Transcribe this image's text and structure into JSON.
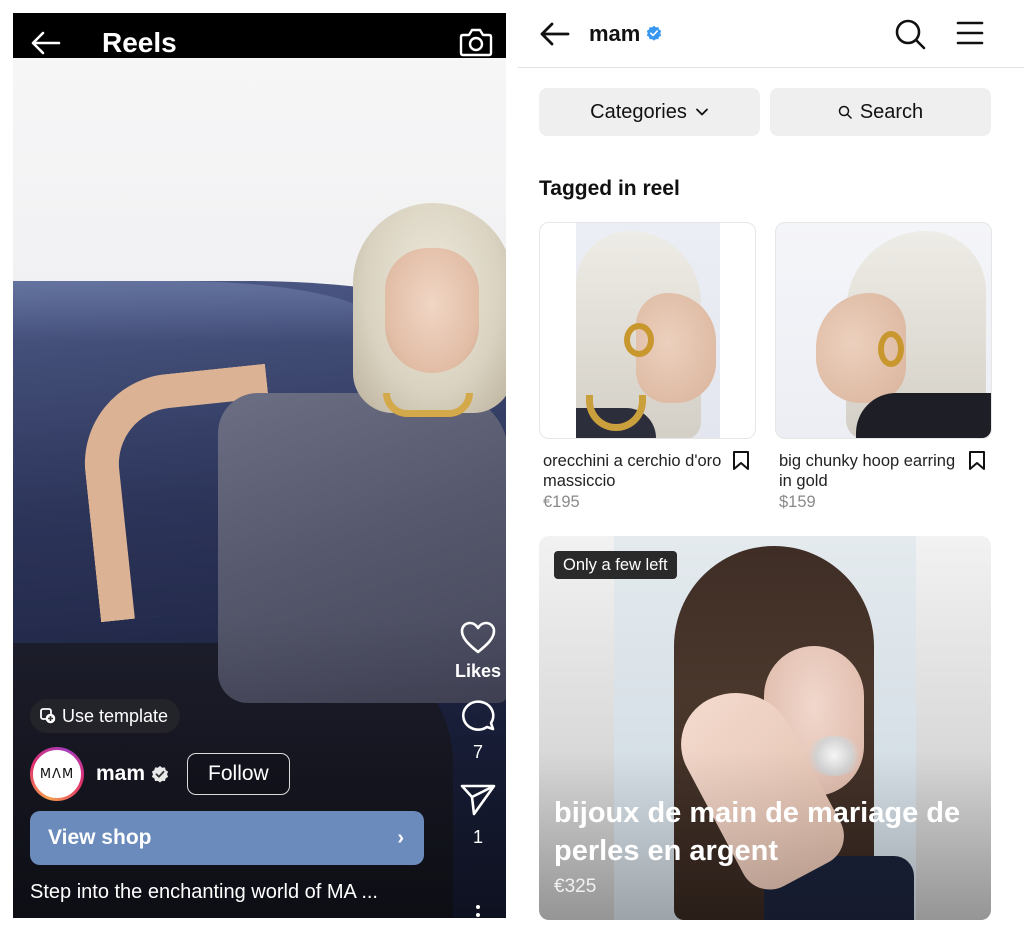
{
  "reels": {
    "header": {
      "title": "Reels",
      "back_icon": "arrow-left-icon",
      "camera_icon": "camera-icon"
    },
    "use_template": {
      "label": "Use template",
      "icon": "template-icon"
    },
    "profile": {
      "avatar_text": "MΛM",
      "username": "mam",
      "verified": true,
      "follow_label": "Follow"
    },
    "view_shop": {
      "label": "View shop",
      "chevron": "›"
    },
    "caption": "Step into the enchanting world of MA ...",
    "actions": [
      {
        "name": "like",
        "icon": "heart-icon",
        "label": "Likes"
      },
      {
        "name": "comment",
        "icon": "comment-icon",
        "count": "7"
      },
      {
        "name": "share",
        "icon": "send-icon",
        "count": "1"
      }
    ]
  },
  "shop": {
    "header": {
      "username": "mam",
      "verified": true,
      "badge_color": "#3897f0"
    },
    "buttons": {
      "categories": "Categories",
      "search": "Search"
    },
    "section_title": "Tagged in reel",
    "products": [
      {
        "name": "orecchini a cerchio d'oro massiccio",
        "price": "€195"
      },
      {
        "name": "big chunky hoop earring in gold",
        "price": "$159"
      }
    ],
    "featured": {
      "tag": "Only a few left",
      "title": "bijoux de main de mariage de perles en argent",
      "price": "€325"
    }
  },
  "colors": {
    "view_shop_bg": "#6a8bbc",
    "verified_blue": "#3897f0",
    "button_bg": "#efefef"
  }
}
